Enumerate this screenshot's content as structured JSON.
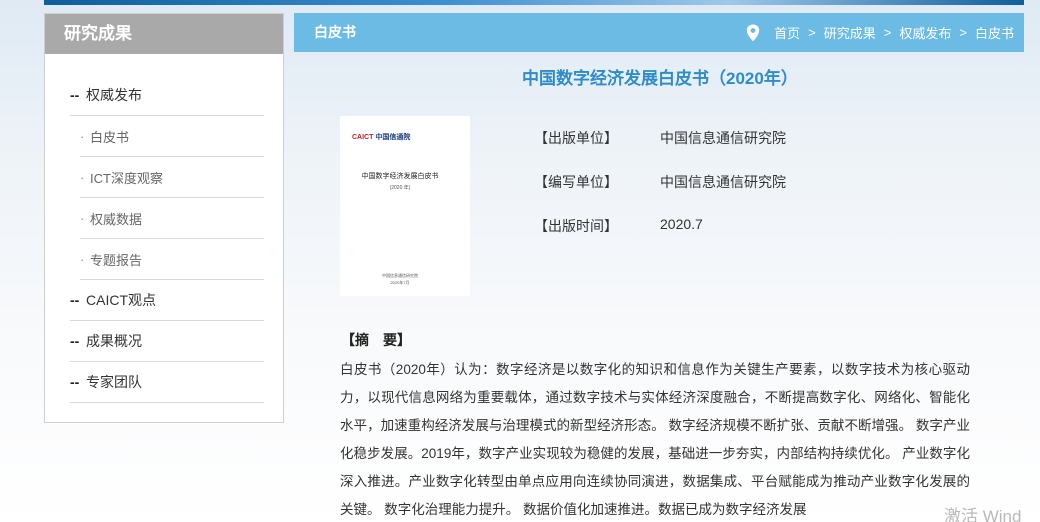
{
  "sidebar": {
    "title": "研究成果",
    "items": [
      {
        "label": "权威发布",
        "subitems": [
          "白皮书",
          "ICT深度观察",
          "权威数据",
          "专题报告"
        ]
      },
      {
        "label": "CAICT观点"
      },
      {
        "label": "成果概况"
      },
      {
        "label": "专家团队"
      }
    ]
  },
  "header": {
    "section_title": "白皮书",
    "breadcrumb": [
      "首页",
      "研究成果",
      "权威发布",
      "白皮书"
    ],
    "breadcrumb_separator": ">",
    "bar_color": "#6bbbe4"
  },
  "document": {
    "title": "中国数字经济发展白皮书（2020年）",
    "title_color": "#2f8cc9",
    "cover": {
      "logo_caict": "CAICT",
      "logo_org": "中国信通院",
      "title": "中国数字经济发展白皮书",
      "year": "(2020 年)",
      "org": "中国信息通信研究院",
      "date": "2020年7月"
    },
    "meta": [
      {
        "key": "【出版单位】",
        "value": "中国信息通信研究院"
      },
      {
        "key": "【编写单位】",
        "value": "中国信息通信研究院"
      },
      {
        "key": "【出版时间】",
        "value": "2020.7"
      }
    ],
    "abstract_heading": "【摘　要】",
    "abstract_text": "白皮书（2020年）认为：数字经济是以数字化的知识和信息作为关键生产要素，以数字技术为核心驱动力，以现代信息网络为重要载体，通过数字技术与实体经济深度融合，不断提高数字化、网络化、智能化水平，加速重构经济发展与治理模式的新型经济形态。 数字经济规模不断扩张、贡献不断增强。 数字产业化稳步发展。2019年，数字产业实现较为稳健的发展，基础进一步夯实，内部结构持续优化。 产业数字化深入推进。产业数字化转型由单点应用向连续协同演进，数据集成、平台赋能成为推动产业数字化发展的关键。 数字化治理能力提升。 数据价值化加速推进。数据已成为数字经济发展"
  },
  "watermark": "激活 Wind"
}
